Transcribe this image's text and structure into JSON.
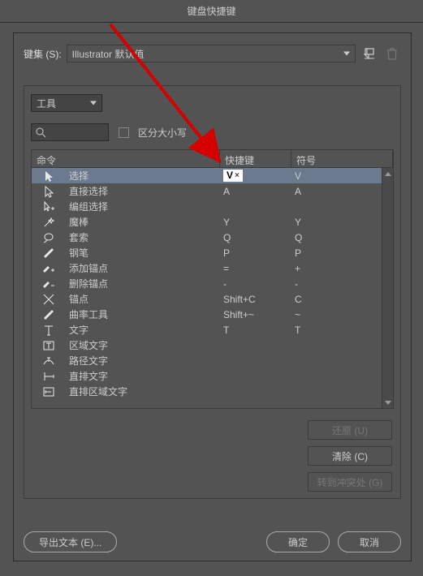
{
  "title": "键盘快捷键",
  "keyset_label": "键集 (S):",
  "keyset_value": "Illustrator 默认值",
  "category": "工具",
  "search_value": "",
  "case_label": "区分大小写",
  "headers": {
    "cmd": "命令",
    "shortcut": "快捷键",
    "symbol": "符号"
  },
  "rows": [
    {
      "name": "选择",
      "shortcut": "V",
      "symbol": "V",
      "selected": true,
      "editing": true,
      "icon": "cursor"
    },
    {
      "name": "直接选择",
      "shortcut": "A",
      "symbol": "A",
      "icon": "cursor-white"
    },
    {
      "name": "编组选择",
      "shortcut": "",
      "symbol": "",
      "icon": "cursor-plus"
    },
    {
      "name": "魔棒",
      "shortcut": "Y",
      "symbol": "Y",
      "icon": "wand"
    },
    {
      "name": "套索",
      "shortcut": "Q",
      "symbol": "Q",
      "icon": "lasso"
    },
    {
      "name": "钢笔",
      "shortcut": "P",
      "symbol": "P",
      "icon": "pen"
    },
    {
      "name": "添加锚点",
      "shortcut": "=",
      "symbol": "+",
      "icon": "pen-plus"
    },
    {
      "name": "删除锚点",
      "shortcut": "-",
      "symbol": "-",
      "icon": "pen-minus"
    },
    {
      "name": "锚点",
      "shortcut": "Shift+C",
      "symbol": "C",
      "icon": "anchor"
    },
    {
      "name": "曲率工具",
      "shortcut": "Shift+~",
      "symbol": "~",
      "icon": "curve"
    },
    {
      "name": "文字",
      "shortcut": "T",
      "symbol": "T",
      "icon": "type"
    },
    {
      "name": "区域文字",
      "shortcut": "",
      "symbol": "",
      "icon": "area-type"
    },
    {
      "name": "路径文字",
      "shortcut": "",
      "symbol": "",
      "icon": "path-type"
    },
    {
      "name": "直排文字",
      "shortcut": "",
      "symbol": "",
      "icon": "vtype"
    },
    {
      "name": "直排区域文字",
      "shortcut": "",
      "symbol": "",
      "icon": "varea-type"
    }
  ],
  "buttons": {
    "undo": "还原 (U)",
    "clear": "清除 (C)",
    "goto": "转到冲突处 (G)",
    "export": "导出文本 (E)...",
    "ok": "确定",
    "cancel": "取消"
  }
}
